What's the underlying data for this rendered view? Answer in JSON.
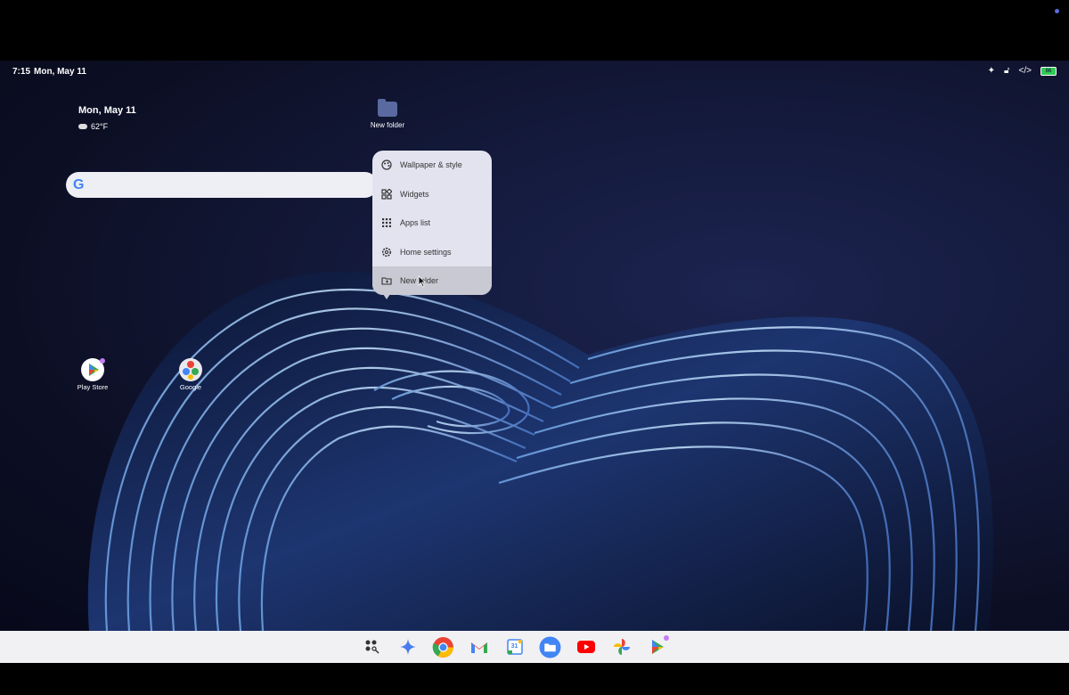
{
  "status_bar": {
    "time": "7:15",
    "date": "Mon, May 11",
    "icons": [
      "sparkle-icon",
      "lock-icon",
      "code-icon",
      "battery-icon"
    ],
    "battery": "86"
  },
  "glance": {
    "date": "Mon, May 11",
    "temperature": "62°F"
  },
  "desktop_folder": {
    "label": "New folder"
  },
  "search": {
    "logo": "G"
  },
  "context_menu": {
    "items": [
      {
        "label": "Wallpaper & style",
        "icon": "palette-icon"
      },
      {
        "label": "Widgets",
        "icon": "widgets-icon"
      },
      {
        "label": "Apps list",
        "icon": "grid-icon"
      },
      {
        "label": "Home settings",
        "icon": "gear-icon"
      },
      {
        "label": "New folder",
        "icon": "folder-add-icon",
        "highlighted": true
      }
    ]
  },
  "desktop_apps": [
    {
      "label": "Play Store"
    },
    {
      "label": "Google"
    }
  ],
  "shelf": {
    "apps": [
      "launcher-icon",
      "gemini-icon",
      "chrome-icon",
      "gmail-icon",
      "calendar-icon",
      "files-icon",
      "youtube-icon",
      "photos-icon",
      "play-store-icon"
    ],
    "calendar_day": "31"
  },
  "colors": {
    "wallpaper_dark": "#07081a",
    "wallpaper_blue": "#1c2450",
    "menu_bg": "#e2e3ef",
    "shelf_bg": "#f1f1f4",
    "accent": "#4285f4"
  }
}
